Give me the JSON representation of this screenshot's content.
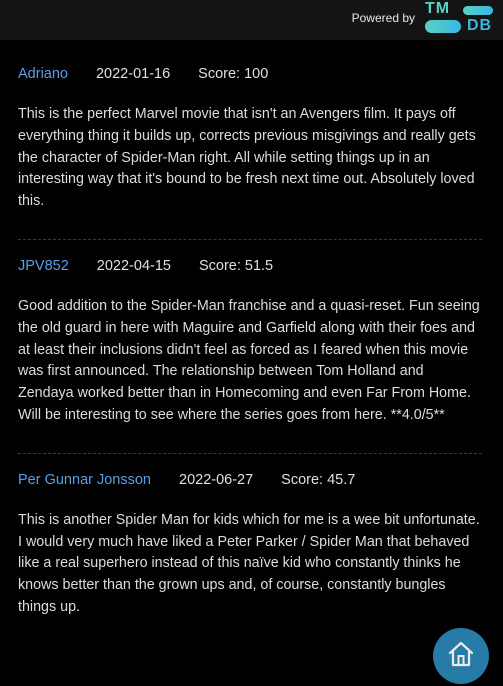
{
  "header": {
    "powered_by": "Powered by",
    "logo_top": "TM",
    "logo_bottom": "DB"
  },
  "reviews": [
    {
      "author": "Adriano",
      "date": "2022-01-16",
      "score": "Score: 100",
      "text": "This is the perfect Marvel movie that isn't an Avengers film. It pays off everything thing it builds up, corrects previous misgivings and really gets the character of Spider-Man right. All while setting things up in an interesting way that it's bound to be fresh next time out. Absolutely loved this."
    },
    {
      "author": "JPV852",
      "date": "2022-04-15",
      "score": "Score: 51.5",
      "text": "Good addition to the Spider-Man franchise and a quasi-reset. Fun seeing the old guard in here with Maguire and Garfield along with their foes and at least their inclusions didn't feel as forced as I feared when this movie was first announced. The relationship between Tom Holland and Zendaya worked better than in Homecoming and even Far From Home. Will be interesting to see where the series goes from here. **4.0/5**"
    },
    {
      "author": "Per Gunnar Jonsson",
      "date": "2022-06-27",
      "score": "Score: 45.7",
      "text": "This is another Spider Man for kids which for me is a wee bit unfortunate. I would very much have liked a Peter Parker / Spider Man that behaved like a real superhero instead of this naïve kid who constantly thinks he knows better than the grown ups and, of course, constantly bungles things up."
    }
  ],
  "home_button": {
    "icon": "home-icon",
    "color": "#2a86b6"
  },
  "colors": {
    "author_link": "#5b9ee6",
    "background": "#000000",
    "tmdb_green": "#5ad3c0",
    "tmdb_blue": "#38b6e4"
  }
}
